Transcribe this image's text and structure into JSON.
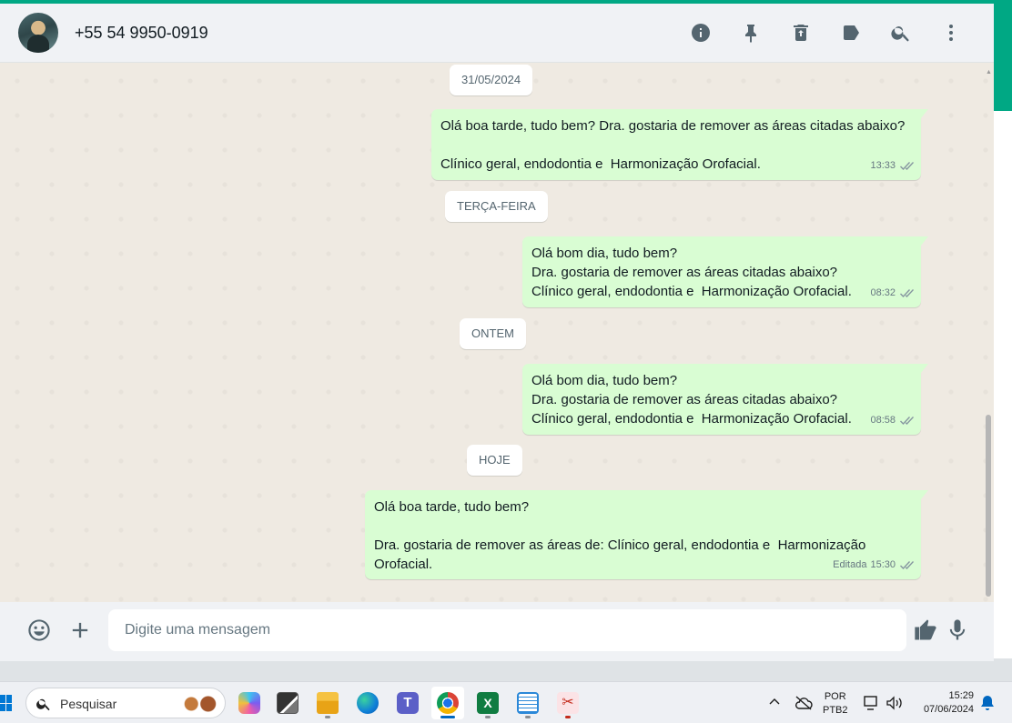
{
  "colors": {
    "accent": "#00a884",
    "bubble_out": "#d9fdd3",
    "chat_bg": "#efeae2",
    "header_bg": "#f0f2f5"
  },
  "header": {
    "contact": "+55 54 9950-0919",
    "icons": [
      "info-icon",
      "pin-icon",
      "delete-icon",
      "label-icon",
      "search-icon",
      "menu-icon"
    ]
  },
  "chat": {
    "dates": [
      "31/05/2024",
      "TERÇA-FEIRA",
      "ONTEM",
      "HOJE"
    ],
    "messages": [
      {
        "lines": [
          "Olá boa tarde, tudo bem? Dra. gostaria de remover as áreas citadas abaixo?",
          "",
          "Clínico geral, endodontia e  Harmonização Orofacial."
        ],
        "time": "13:33",
        "status": "read"
      },
      {
        "lines": [
          "Olá bom dia, tudo bem?",
          "Dra. gostaria de remover as áreas citadas abaixo?",
          "Clínico geral, endodontia e  Harmonização Orofacial."
        ],
        "time": "08:32",
        "status": "read"
      },
      {
        "lines": [
          "Olá bom dia, tudo bem?",
          "Dra. gostaria de remover as áreas citadas abaixo?",
          "Clínico geral, endodontia e  Harmonização Orofacial."
        ],
        "time": "08:58",
        "status": "read"
      },
      {
        "lines": [
          "Olá boa tarde, tudo bem?",
          "",
          "Dra. gostaria de remover as áreas de: Clínico geral, endodontia e  Harmonização",
          "Orofacial."
        ],
        "edited": "Editada",
        "time": "15:30",
        "status": "read"
      }
    ]
  },
  "composer": {
    "placeholder": "Digite uma mensagem",
    "icons": [
      "emoji-icon",
      "attach-plus-icon",
      "thumbs-up-icon",
      "microphone-icon"
    ]
  },
  "taskbar": {
    "search_label": "Pesquisar",
    "apps": [
      "copilot",
      "task-view",
      "file-explorer",
      "edge",
      "teams",
      "chrome",
      "excel",
      "notepad",
      "snipping-tool"
    ],
    "active_app": "chrome",
    "language": [
      "POR",
      "PTB2"
    ],
    "time": "15:29",
    "date": "07/06/2024"
  }
}
